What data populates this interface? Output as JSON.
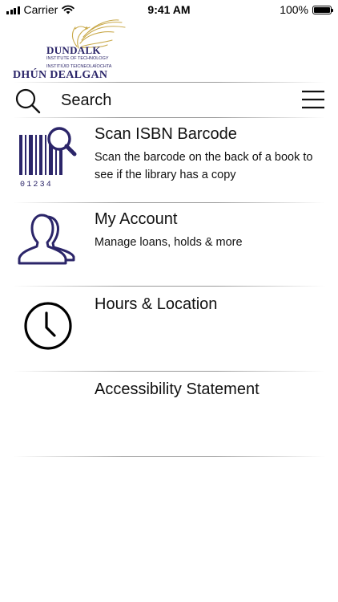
{
  "status_bar": {
    "carrier": "Carrier",
    "time": "9:41 AM",
    "battery": "100%",
    "battery_level": 1.0
  },
  "logo": {
    "line1": "DUNDALK",
    "line2": "INSTITUTE OF TECHNOLOGY",
    "line3": "INSTITIÚID TEICNEOLAÍOCHTA",
    "line4": "DHÚN DEALGAN"
  },
  "search": {
    "placeholder": "Search",
    "icon": "search-icon"
  },
  "menu_icon": "hamburger-menu-icon",
  "items": [
    {
      "title": "Scan ISBN Barcode",
      "description": "Scan the barcode on the back of a book to see if the library has a copy",
      "icon": "barcode-scan-icon",
      "barcode_digits": "01234"
    },
    {
      "title": "My Account",
      "description": "Manage loans, holds & more",
      "icon": "users-icon"
    },
    {
      "title": "Hours & Location",
      "description": "",
      "icon": "clock-icon"
    },
    {
      "title": "Accessibility Statement",
      "description": "",
      "icon": ""
    }
  ],
  "colors": {
    "brand_navy": "#2b2569",
    "logo_gold": "#c9a94a",
    "text": "#111111",
    "divider": "#9a9a9a"
  }
}
